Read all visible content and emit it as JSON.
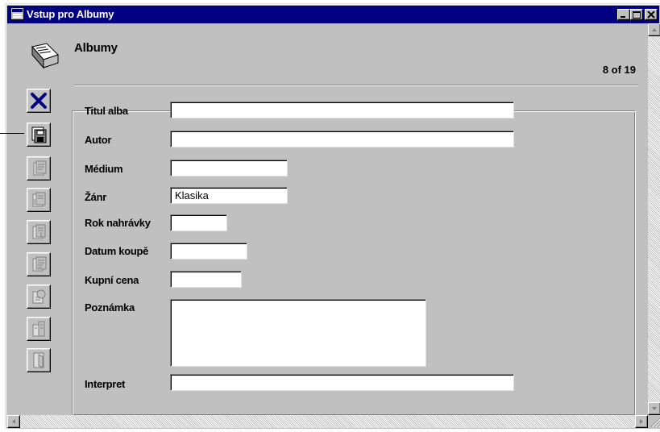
{
  "window": {
    "title": "Vstup pro Albumy",
    "accent": "#000080"
  },
  "form": {
    "title": "Albumy",
    "record_count": "8 of 19"
  },
  "toolbar": {
    "buttons": [
      {
        "icon": "delete-x-icon"
      },
      {
        "icon": "save-disk-icon"
      },
      {
        "icon": "first-record-icon"
      },
      {
        "icon": "previous-record-icon"
      },
      {
        "icon": "next-record-icon"
      },
      {
        "icon": "last-record-icon"
      },
      {
        "icon": "find-record-icon"
      },
      {
        "icon": "new-record-icon"
      },
      {
        "icon": "close-form-icon"
      }
    ]
  },
  "fields": {
    "titul_alba": {
      "label": "Titul alba",
      "value": ""
    },
    "autor": {
      "label": "Autor",
      "value": ""
    },
    "medium": {
      "label": "Médium",
      "value": ""
    },
    "zanr": {
      "label": "Žánr",
      "value": "Klasika"
    },
    "rok_nahravky": {
      "label": "Rok nahrávky",
      "value": ""
    },
    "datum_koupe": {
      "label": "Datum koupě",
      "value": ""
    },
    "kupni_cena": {
      "label": "Kupní cena",
      "value": ""
    },
    "poznamka": {
      "label": "Poznámka",
      "value": ""
    },
    "interpret": {
      "label": "Interpret",
      "value": ""
    }
  }
}
